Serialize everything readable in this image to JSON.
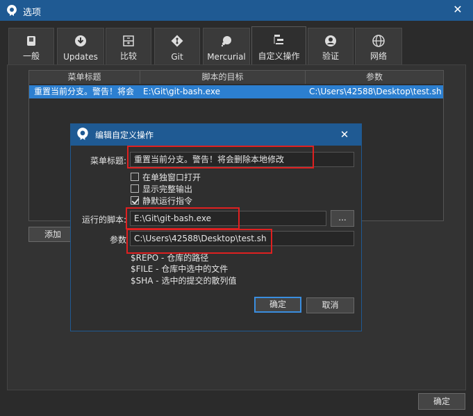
{
  "window": {
    "title": "选项",
    "close_glyph": "✕"
  },
  "tabs": [
    {
      "label": "一般",
      "icon": "switch-icon"
    },
    {
      "label": "Updates",
      "icon": "download-icon"
    },
    {
      "label": "比较",
      "icon": "diff-icon"
    },
    {
      "label": "Git",
      "icon": "git-icon"
    },
    {
      "label": "Mercurial",
      "icon": "mercurial-icon"
    },
    {
      "label": "自定义操作",
      "icon": "custom-actions-icon"
    },
    {
      "label": "验证",
      "icon": "user-icon"
    },
    {
      "label": "网络",
      "icon": "globe-icon"
    }
  ],
  "active_tab": "自定义操作",
  "table": {
    "headers": [
      "菜单标题",
      "脚本的目标",
      "参数"
    ],
    "rows": [
      {
        "title": "重置当前分支。警告！将会",
        "target": "E:\\Git\\git-bash.exe",
        "params": "C:\\Users\\42588\\Desktop\\test.sh"
      }
    ]
  },
  "add_button": "添加",
  "ok_button": "确定",
  "dialog": {
    "title": "编辑自定义操作",
    "close_glyph": "✕",
    "menu_title_label": "菜单标题:",
    "menu_title_value": "重置当前分支。警告！将会删除本地修改",
    "options": [
      {
        "label": "在单独窗口打开",
        "checked": false
      },
      {
        "label": "显示完整输出",
        "checked": false
      },
      {
        "label": "静默运行指令",
        "checked": true
      }
    ],
    "script_label": "运行的脚本:",
    "script_value": "E:\\Git\\git-bash.exe",
    "browse_button": "...",
    "params_label": "参数",
    "params_value": "C:\\Users\\42588\\Desktop\\test.sh",
    "hints": [
      "$REPO - 仓库的路径",
      "$FILE - 仓库中选中的文件",
      "$SHA - 选中的提交的散列值"
    ],
    "ok_button": "确定",
    "cancel_button": "取消"
  },
  "colors": {
    "titlebar": "#1f5a93",
    "selection": "#2c7fd0",
    "highlight_box": "#e02020",
    "primary_border": "#3a8ee0"
  }
}
